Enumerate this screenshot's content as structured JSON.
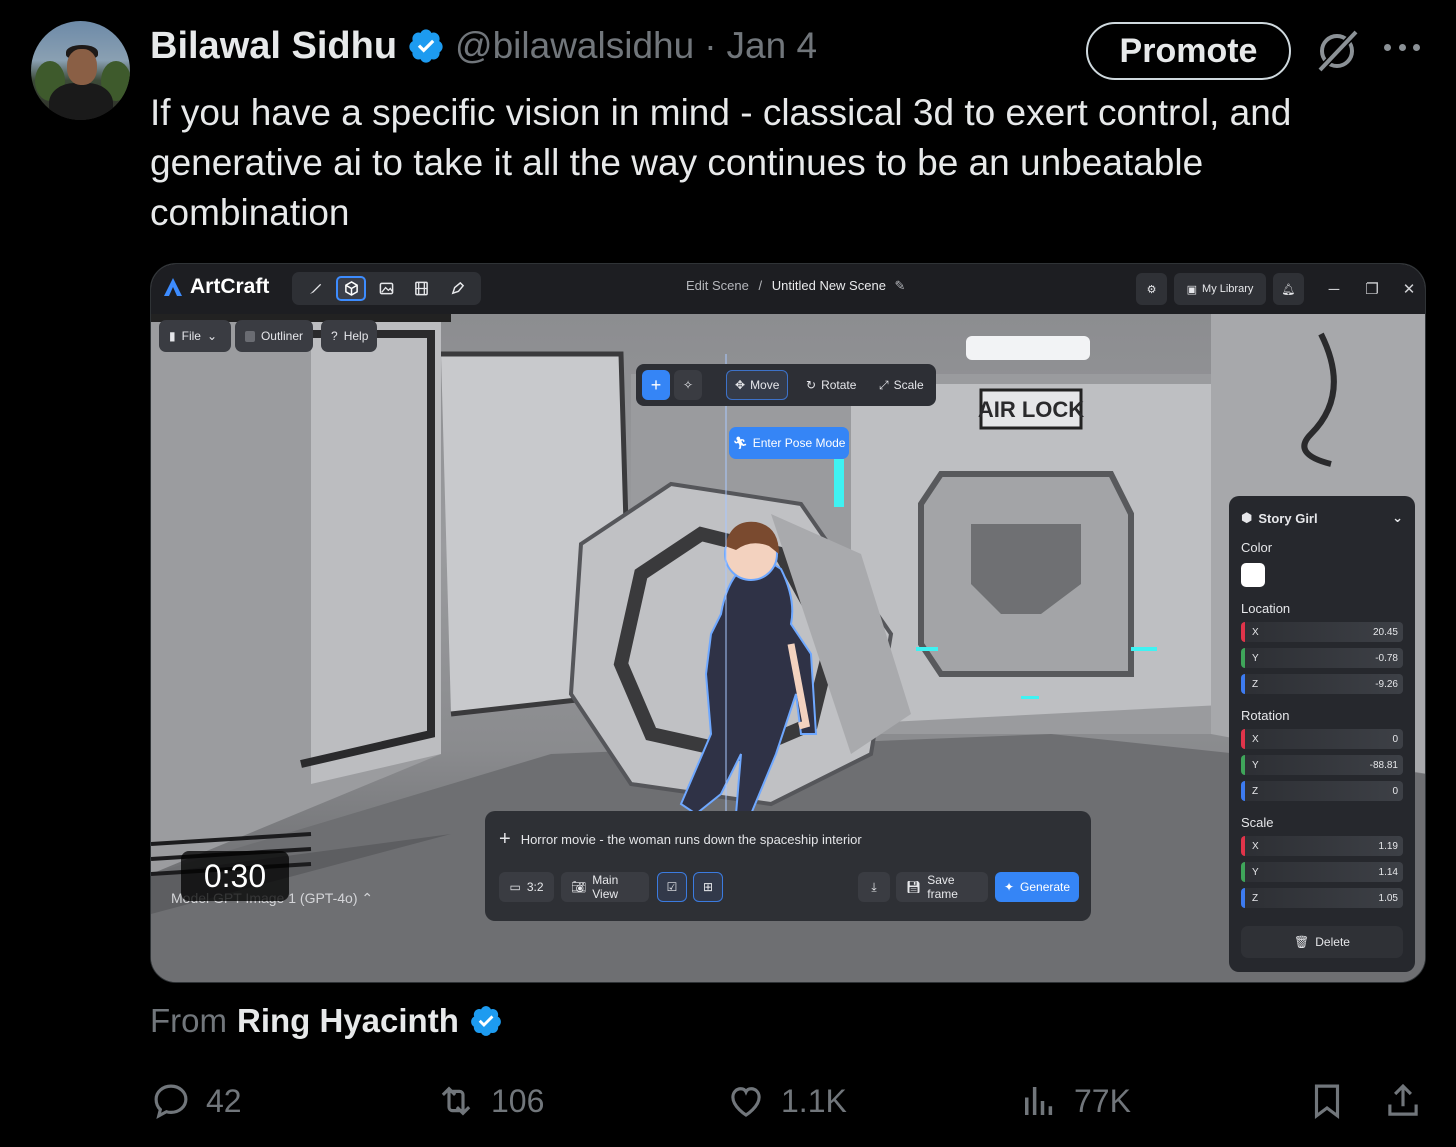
{
  "tweet": {
    "author_name": "Bilawal Sidhu",
    "handle": "@bilawalsidhu",
    "separator": "·",
    "date": "Jan 4",
    "promote_label": "Promote",
    "text_lines": [
      "If you have a specific vision in mind - classical 3d to exert control, and",
      "generative ai to take it all the way continues to be an unbeatable",
      "combination"
    ],
    "from_prefix": "From",
    "from_source": "Ring Hyacinth",
    "stats": {
      "replies": "42",
      "reposts": "106",
      "likes": "1.1K",
      "views": "77K"
    }
  },
  "app": {
    "name": "ArtCraft",
    "breadcrumb_parent": "Edit Scene",
    "breadcrumb_sep": "/",
    "breadcrumb_current": "Untitled New Scene",
    "my_library": "My Library",
    "file_menu": "File",
    "outliner": "Outliner",
    "help": "Help",
    "toolbar": {
      "move": "Move",
      "rotate": "Rotate",
      "scale": "Scale",
      "pose_mode": "Enter Pose Mode"
    },
    "scene_sign": "AIR LOCK",
    "panel": {
      "title": "Story Girl",
      "color_label": "Color",
      "location_label": "Location",
      "location": {
        "x": "20.45",
        "y": "-0.78",
        "z": "-9.26"
      },
      "rotation_label": "Rotation",
      "rotation": {
        "x": "0",
        "y": "-88.81",
        "z": "0"
      },
      "scale_label": "Scale",
      "scale": {
        "x": "1.19",
        "y": "1.14",
        "z": "1.05"
      },
      "axis_x": "X",
      "axis_y": "Y",
      "axis_z": "Z",
      "delete": "Delete"
    },
    "prompt": {
      "text": "Horror movie - the woman runs down the spaceship interior",
      "aspect": "3:2",
      "view": "Main View",
      "save_frame": "Save frame",
      "generate": "Generate"
    },
    "model_label": "Model GPT Image 1 (GPT-4o)",
    "timer": "0:30"
  },
  "colors": {
    "accent_blue": "#3585f6",
    "verified_blue": "#1d9bf0",
    "axis_x": "#e0344a",
    "axis_y": "#3fa55a",
    "axis_z": "#3d7bf0"
  }
}
